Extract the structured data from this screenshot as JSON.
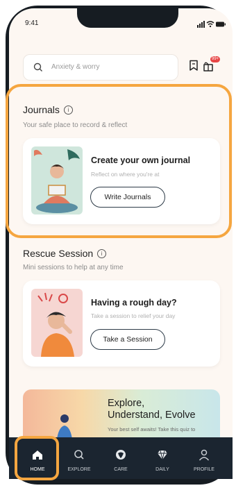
{
  "status_bar": {
    "time": "9:41"
  },
  "search": {
    "placeholder": "Anxiety & worry"
  },
  "notification_badge": "99+",
  "journals": {
    "title": "Journals",
    "subtitle": "Your safe place to record & reflect",
    "card_title": "Create your own journal",
    "card_subtitle": "Reflect on where you're at",
    "button": "Write Journals"
  },
  "rescue": {
    "title": "Rescue Session",
    "subtitle": "Mini sessions to help at any time",
    "card_title": "Having a rough day?",
    "card_subtitle": "Take a session to relief your day",
    "button": "Take a Session"
  },
  "promo": {
    "title_line1": "Explore,",
    "title_line2": "Understand, Evolve",
    "text": "Your best self awaits! Take this quiz to"
  },
  "nav": [
    {
      "label": "HOME",
      "icon": "home-icon",
      "active": true
    },
    {
      "label": "EXPLORE",
      "icon": "search-icon",
      "active": false
    },
    {
      "label": "CARE",
      "icon": "care-icon",
      "active": false
    },
    {
      "label": "DAILY",
      "icon": "diamond-icon",
      "active": false
    },
    {
      "label": "PROFILE",
      "icon": "profile-icon",
      "active": false
    }
  ],
  "colors": {
    "highlight": "#f5a640",
    "background": "#fdf7f2",
    "nav_bar": "#1b2530",
    "badge": "#e74646"
  }
}
